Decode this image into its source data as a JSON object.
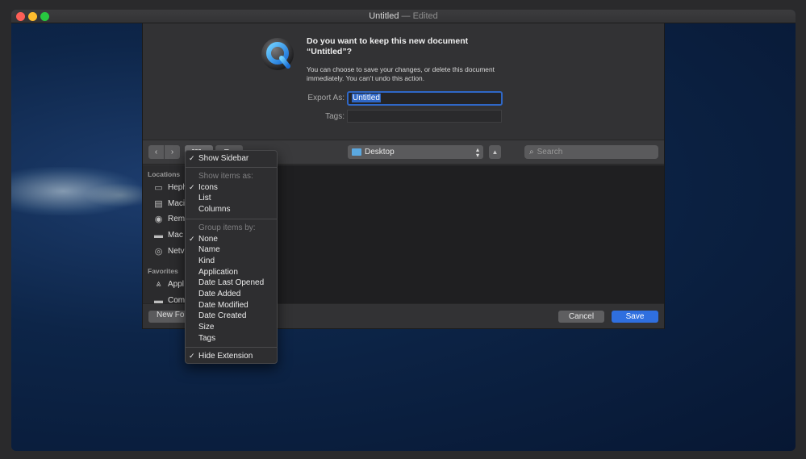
{
  "window": {
    "title": "Untitled",
    "title_suffix": " — Edited"
  },
  "prompt": {
    "title": "Do you want to keep this new document “Untitled”?",
    "body": "You can choose to save your changes, or delete this document immediately. You can’t undo this action.",
    "export_label": "Export As:",
    "export_value": "Untitled",
    "tags_label": "Tags:"
  },
  "toolbar": {
    "location": "Desktop",
    "search_placeholder": "Search"
  },
  "sidebar": {
    "locations_header": "Locations",
    "favorites_header": "Favorites",
    "locations": [
      {
        "label": "Heph",
        "icon": "display-icon"
      },
      {
        "label": "Maci",
        "icon": "disk-icon"
      },
      {
        "label": "Rem",
        "icon": "cd-icon"
      },
      {
        "label": "Mac",
        "icon": "laptop-icon"
      },
      {
        "label": "Netv",
        "icon": "globe-icon"
      }
    ],
    "favorites": [
      {
        "label": "Appl",
        "icon": "applications-icon"
      },
      {
        "label": "Com",
        "icon": "folder-icon"
      }
    ]
  },
  "bottom": {
    "new_folder": "New Folder",
    "cancel": "Cancel",
    "save": "Save"
  },
  "menu": {
    "show_sidebar": "Show Sidebar",
    "show_items_header": "Show items as:",
    "icons": "Icons",
    "list": "List",
    "columns": "Columns",
    "group_header": "Group items by:",
    "none": "None",
    "name": "Name",
    "kind": "Kind",
    "application": "Application",
    "date_last_opened": "Date Last Opened",
    "date_added": "Date Added",
    "date_modified": "Date Modified",
    "date_created": "Date Created",
    "size": "Size",
    "tags": "Tags",
    "hide_extension": "Hide Extension",
    "check": "✓"
  },
  "colors": {
    "accent": "#2f6fdf",
    "selection": "#2f67c6"
  }
}
